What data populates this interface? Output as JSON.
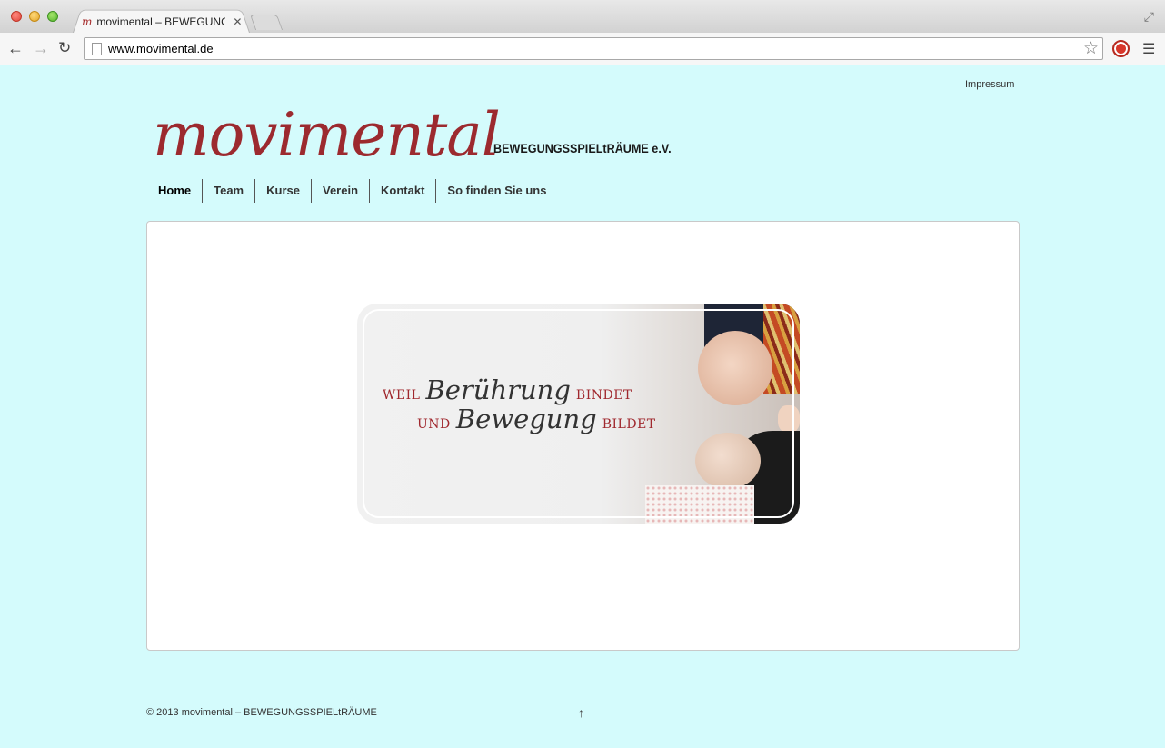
{
  "browser": {
    "tab_title": "movimental – BEWEGUNGS",
    "tab_favicon": "m",
    "tab_close": "✕",
    "url": "www.movimental.de"
  },
  "page": {
    "impressum_link": "Impressum",
    "logo": {
      "main": "movimental",
      "sub": "BEWEGUNGSSPIELtRÄUME e.V."
    },
    "nav": [
      "Home",
      "Team",
      "Kurse",
      "Verein",
      "Kontakt",
      "So finden Sie uns"
    ],
    "active_nav": "Home",
    "hero": {
      "line1_a": "weil",
      "line1_b": "Berührung",
      "line1_c": "bindet",
      "line2_a": "und",
      "line2_b": "Bewegung",
      "line2_c": "bildet"
    },
    "footer": {
      "copyright": "© 2013 movimental – BEWEGUNGSSPIELtRÄUME",
      "up_arrow": "↑"
    }
  },
  "colors": {
    "background": "#d4fbfc",
    "brand_red": "#9c2a2f",
    "content_bg": "#ffffff"
  }
}
